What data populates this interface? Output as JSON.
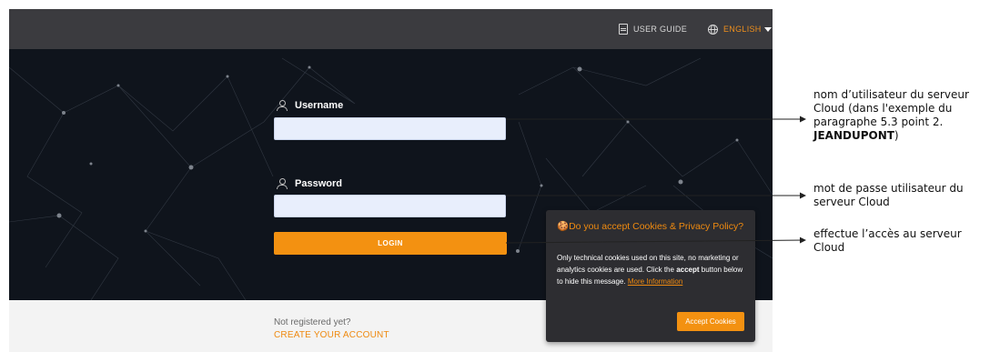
{
  "topbar": {
    "user_guide": "USER GUIDE",
    "language": "ENGLISH"
  },
  "login": {
    "username_label": "Username",
    "password_label": "Password",
    "login_button": "LOGIN"
  },
  "footer": {
    "not_registered": "Not registered yet?",
    "create_account": "CREATE YOUR ACCOUNT"
  },
  "cookie": {
    "title": "Do you accept Cookies & Privacy Policy?",
    "body_part1": "Only technical cookies used on this site, no marketing or analytics cookies are used. Click the",
    "body_bold": "accept",
    "body_part2": "button below to hide this message.",
    "more_information": "More Information",
    "accept_button": "Accept Cookies"
  },
  "annotations": {
    "username_note_text": "nom d’utilisateur du serveur Cloud (dans l'exemple du paragraphe 5.3 point 2.",
    "username_note_bold": "JEANDUPONT",
    "username_note_end": ")",
    "password_note": "mot de passe utilisateur du serveur Cloud",
    "login_note": "effectue l’accès au serveur Cloud"
  },
  "colors": {
    "accent": "#f39111",
    "topbar": "#3b3b3f",
    "hero": "#0f141c",
    "popup": "#2d2d31"
  }
}
